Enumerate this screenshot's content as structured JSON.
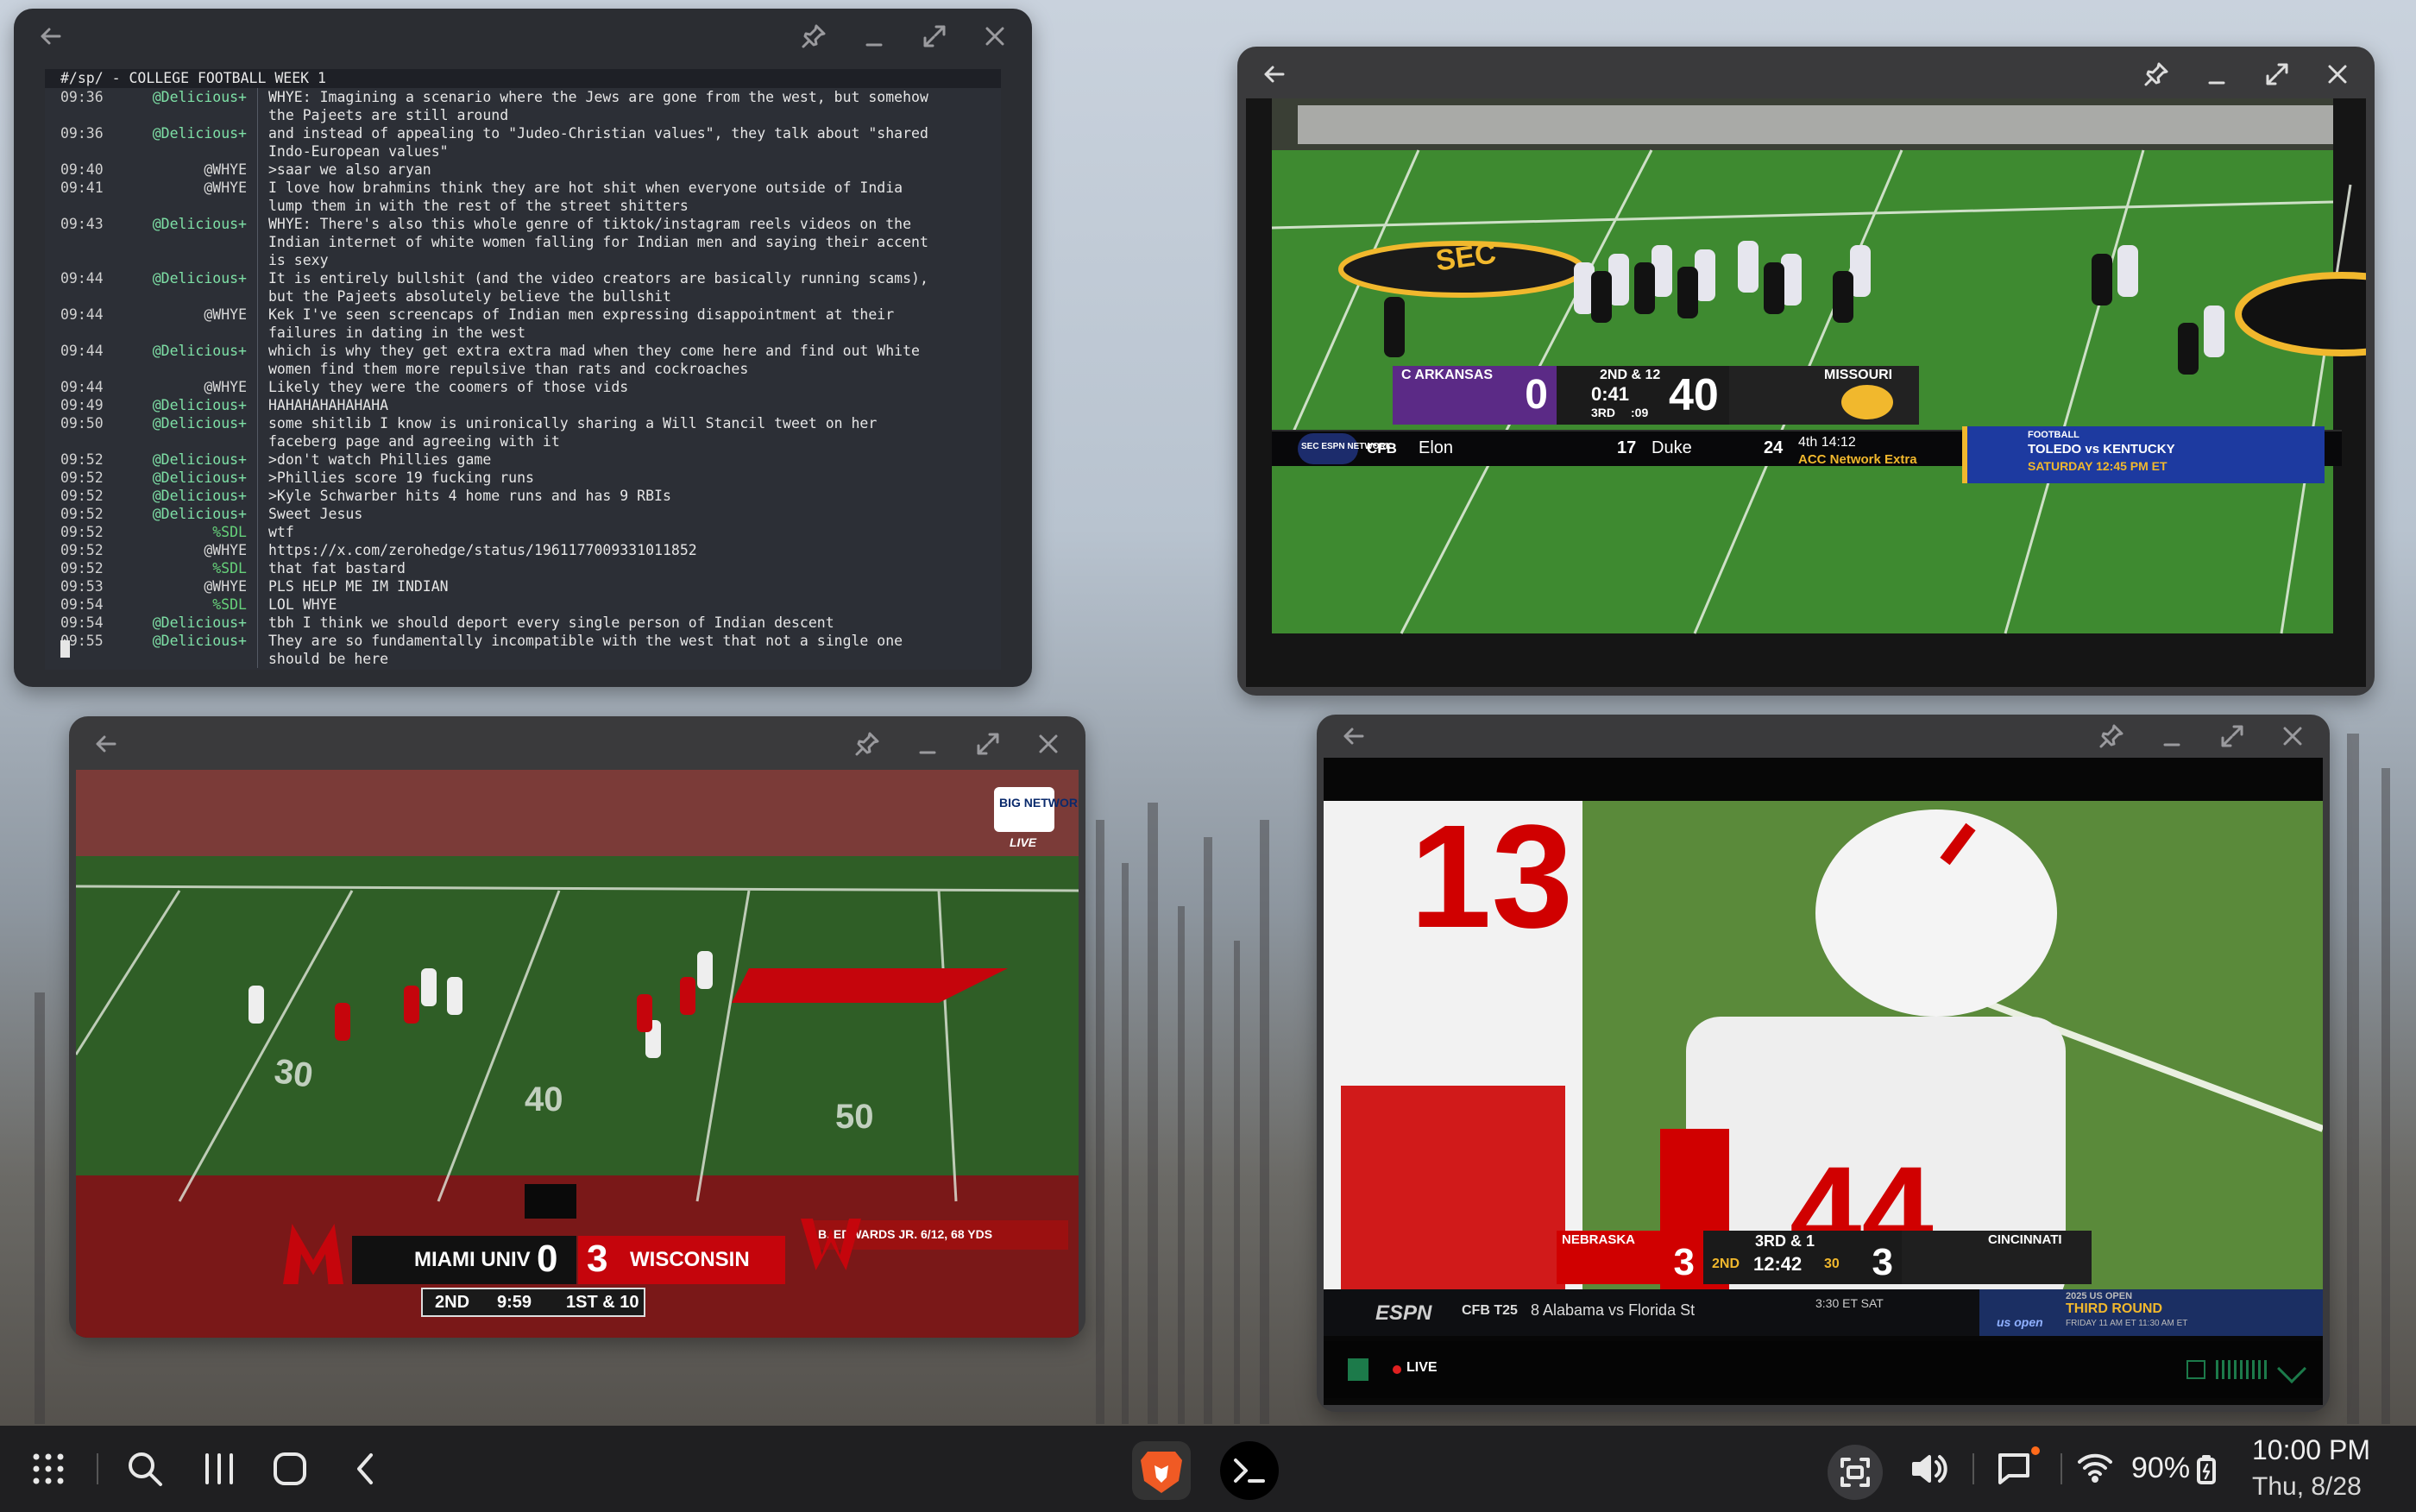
{
  "terminal": {
    "channel_title": "#/sp/ - COLLEGE FOOTBALL WEEK 1",
    "lines": [
      {
        "ts": "09:36",
        "nick": "@Delicious+",
        "msg": "WHYE: Imagining a scenario where the Jews are gone from the west, but somehow\nthe Pajeets are still around"
      },
      {
        "ts": "09:36",
        "nick": "@Delicious+",
        "msg": "and instead of appealing to \"Judeo-Christian values\", they talk about \"shared\nIndo-European values\""
      },
      {
        "ts": "09:40",
        "nick": "@WHYE",
        "msg": ">saar we also aryan"
      },
      {
        "ts": "09:41",
        "nick": "@WHYE",
        "msg": "I love how brahmins think they are hot shit when everyone outside of India\nlump them in with the rest of the street shitters"
      },
      {
        "ts": "09:43",
        "nick": "@Delicious+",
        "msg": "WHYE: There's also this whole genre of tiktok/instagram reels videos on the\nIndian internet of white women falling for Indian men and saying their accent\nis sexy"
      },
      {
        "ts": "09:44",
        "nick": "@Delicious+",
        "msg": "It is entirely bullshit (and the video creators are basically running scams),\nbut the Pajeets absolutely believe the bullshit"
      },
      {
        "ts": "09:44",
        "nick": "@WHYE",
        "msg": "Kek I've seen screencaps of Indian men expressing disappointment at their\nfailures in dating in the west"
      },
      {
        "ts": "09:44",
        "nick": "@Delicious+",
        "msg": "which is why they get extra extra mad when they come here and find out White\nwomen find them more repulsive than rats and cockroaches"
      },
      {
        "ts": "09:44",
        "nick": "@WHYE",
        "msg": "Likely they were the coomers of those vids"
      },
      {
        "ts": "09:49",
        "nick": "@Delicious+",
        "msg": "HAHAHAHAHAHAHA"
      },
      {
        "ts": "09:50",
        "nick": "@Delicious+",
        "msg": "some shitlib I know is unironically sharing a Will Stancil tweet on her\nfaceberg page and agreeing with it"
      },
      {
        "ts": "09:52",
        "nick": "@Delicious+",
        "msg": ">don't watch Phillies game"
      },
      {
        "ts": "09:52",
        "nick": "@Delicious+",
        "msg": ">Phillies score 19 fucking runs"
      },
      {
        "ts": "09:52",
        "nick": "@Delicious+",
        "msg": ">Kyle Schwarber hits 4 home runs and has 9 RBIs"
      },
      {
        "ts": "09:52",
        "nick": "@Delicious+",
        "msg": "Sweet Jesus"
      },
      {
        "ts": "09:52",
        "nick": "%SDL",
        "msg": "wtf"
      },
      {
        "ts": "09:52",
        "nick": "@WHYE",
        "msg": "https://x.com/zerohedge/status/1961177009331011852"
      },
      {
        "ts": "09:52",
        "nick": "%SDL",
        "msg": "that fat bastard"
      },
      {
        "ts": "09:53",
        "nick": "@WHYE",
        "msg": "PLS HELP ME IM INDIAN"
      },
      {
        "ts": "09:54",
        "nick": "%SDL",
        "msg": "LOL WHYE"
      },
      {
        "ts": "09:54",
        "nick": "@Delicious+",
        "msg": "tbh I think we should deport every single person of Indian descent"
      },
      {
        "ts": "09:55",
        "nick": "@Delicious+",
        "msg": "They are so fundamentally incompatible with the west that not a single one\nshould be here"
      }
    ]
  },
  "sec_game": {
    "away_team": "C ARKANSAS",
    "away_score": "0",
    "home_team": "MISSOURI",
    "home_score": "40",
    "down": "2ND & 12",
    "clock": "0:41",
    "quarter": "3RD",
    "play_clock": ":09",
    "ticker_label": "CFB",
    "ticker_team1": "Elon",
    "ticker_score1": "17",
    "ticker_team2": "Duke",
    "ticker_score2": "24",
    "ticker_time": "4th 14:12",
    "ticker_network": "ACC Network Extra",
    "promo_label": "FOOTBALL",
    "promo_match": "TOLEDO vs KENTUCKY",
    "promo_time": "SATURDAY 12:45 PM ET",
    "end_zone_text": "SEC",
    "network_badge": "SEC ESPN NETWORK"
  },
  "big_ten_game": {
    "network_badge": "BIG NETWORK",
    "network_live": "LIVE",
    "away_team": "MIAMI UNIV",
    "away_score": "0",
    "home_team": "WISCONSIN",
    "home_score": "3",
    "quarter": "2ND",
    "clock": "9:59",
    "down": "1ST & 10",
    "stat_line": "B. EDWARDS JR.  6/12, 68 YDS",
    "yard_30": "30",
    "yard_40": "40",
    "yard_50": "50"
  },
  "espn_game": {
    "away_team": "NEBRASKA",
    "away_score": "3",
    "home_team": "CINCINNATI",
    "home_score": "3",
    "down": "3RD & 1",
    "quarter": "2ND",
    "clock": "12:42",
    "play_clock": "30",
    "ticker_brand": "ESPN",
    "ticker_label": "CFB T25",
    "ticker_match": "8 Alabama vs Florida St",
    "ticker_time": "3:30 ET SAT",
    "promo_title": "2025 US OPEN",
    "promo_round": "THIRD ROUND",
    "promo_time": "FRIDAY 11 AM ET  11:30 AM ET",
    "promo_brand": "us open",
    "live_label": "LIVE",
    "jersey_left": "13",
    "jersey_right": "44"
  },
  "status": {
    "battery": "90%",
    "time": "10:00 PM",
    "date": "Thu, 8/28"
  },
  "colors": {
    "sec_purple": "#5b2a86",
    "missouri_gold": "#f1b82d",
    "wisconsin_red": "#c5050c",
    "nebraska_red": "#d00000",
    "field_green": "#3d7a2e"
  }
}
